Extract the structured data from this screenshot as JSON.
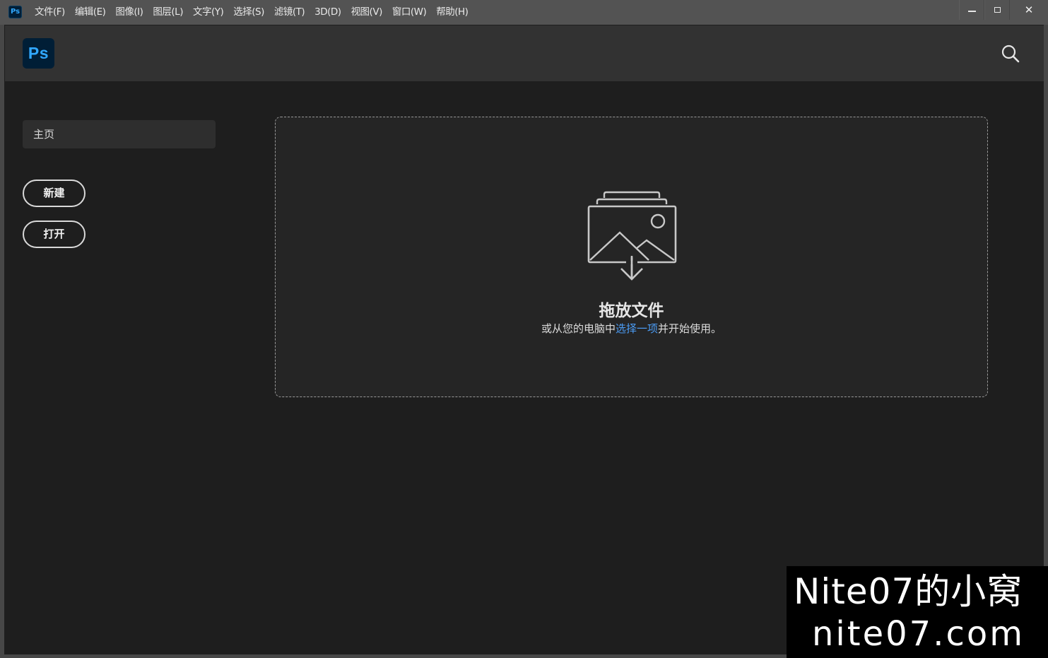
{
  "app": {
    "icon_text": "Ps",
    "logo_text": "Ps",
    "accent_color": "#31a8ff",
    "logo_bg": "#001e36"
  },
  "menu": [
    {
      "label": "文件(F)"
    },
    {
      "label": "编辑(E)"
    },
    {
      "label": "图像(I)"
    },
    {
      "label": "图层(L)"
    },
    {
      "label": "文字(Y)"
    },
    {
      "label": "选择(S)"
    },
    {
      "label": "滤镜(T)"
    },
    {
      "label": "3D(D)"
    },
    {
      "label": "视图(V)"
    },
    {
      "label": "窗口(W)"
    },
    {
      "label": "帮助(H)"
    }
  ],
  "window_controls": {
    "minimize_icon": "minimize-icon",
    "maximize_icon": "maximize-icon",
    "close_icon": "close-icon",
    "close_glyph": "✕"
  },
  "header": {
    "search_icon": "search-icon"
  },
  "sidebar": {
    "home_label": "主页",
    "new_label": "新建",
    "open_label": "打开"
  },
  "drop_zone": {
    "icon": "image-download-icon",
    "title": "拖放文件",
    "subtitle_prefix": "或从您的电脑中",
    "subtitle_link": "选择一项",
    "subtitle_suffix": "并开始使用。",
    "link_color": "#4b9cf5"
  },
  "watermark": {
    "line1": "Nite07的小窝",
    "line2": "nite07.com"
  }
}
